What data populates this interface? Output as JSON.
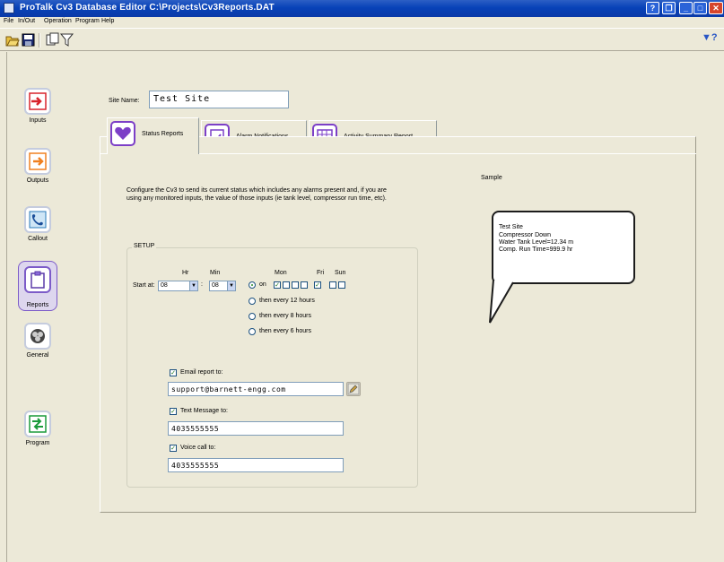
{
  "window": {
    "title": "ProTalk Cv3 Database Editor   C:\\Projects\\Cv3Reports.DAT"
  },
  "menu": [
    "File",
    "In/Out",
    "Operation",
    "Program",
    "Help"
  ],
  "toolbar": {
    "buttons": [
      "open-icon",
      "save-icon",
      "copy-icon",
      "filter-icon"
    ],
    "help_icon": "context-help-icon"
  },
  "sidebar": {
    "items": [
      {
        "label": "Inputs",
        "icon": "inputs-icon"
      },
      {
        "label": "Outputs",
        "icon": "outputs-icon"
      },
      {
        "label": "Callout",
        "icon": "callout-icon"
      },
      {
        "label": "Reports",
        "icon": "reports-icon",
        "selected": true
      },
      {
        "label": "General",
        "icon": "general-icon"
      },
      {
        "label": "Program",
        "icon": "program-icon"
      }
    ]
  },
  "site": {
    "label": "Site Name:",
    "value": "Test Site"
  },
  "tabs": [
    {
      "label": "Status Reports",
      "active": true
    },
    {
      "label": "Alarm Notifications",
      "active": false
    },
    {
      "label": "Activity Summary Report",
      "active": false
    }
  ],
  "description": "Configure the Cv3 to send its current status which includes any alarms present and, if you are using any monitored inputs, the value of those inputs (ie tank level, compressor run time, etc).",
  "setup": {
    "title": "SETUP",
    "start_at_label": "Start at:",
    "hr_label": "Hr",
    "min_label": "Min",
    "hr_value": "08",
    "min_value": "08",
    "day_labels": {
      "mon": "Mon",
      "fri": "Fri",
      "sun": "Sun"
    },
    "on_label": "on",
    "days_checked": [
      true,
      false,
      false,
      false,
      true,
      false,
      false
    ],
    "options": [
      {
        "label": "on",
        "checked": true
      },
      {
        "label": "then every 12 hours",
        "checked": false
      },
      {
        "label": "then every 8 hours",
        "checked": false
      },
      {
        "label": "then every 6 hours",
        "checked": false
      }
    ],
    "email": {
      "label": "Email report to:",
      "checked": true,
      "value": "support@barnett-engg.com"
    },
    "text": {
      "label": "Text Message to:",
      "checked": true,
      "value": "4035555555"
    },
    "voice": {
      "label": "Voice call to:",
      "checked": true,
      "value": "4035555555"
    }
  },
  "sample": {
    "label": "Sample",
    "lines": [
      "Test Site",
      "Compressor Down",
      "Water Tank Level=12.34 m",
      "Comp. Run Time=999.9 hr"
    ]
  },
  "colors": {
    "titlebar": "#0a42b4",
    "accent_purple": "#7c3fc7",
    "inputs_red": "#d8242c",
    "outputs_orange": "#f08020",
    "program_green": "#1a9a3a"
  }
}
